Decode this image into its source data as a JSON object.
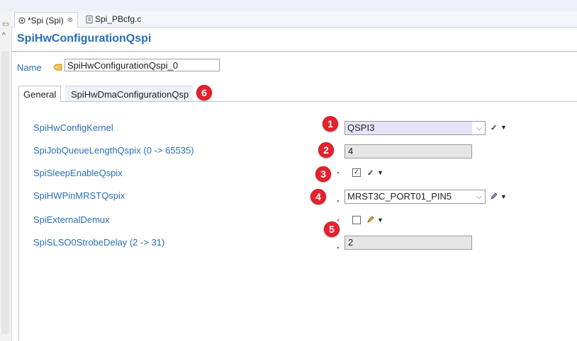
{
  "editor_tabs": [
    {
      "label": "*Spi (Spi)",
      "close": "⊗"
    },
    {
      "label": "Spi_PBcfg.c"
    }
  ],
  "section_title": "SpiHwConfigurationQspi",
  "name_field": {
    "label": "Name",
    "value": "SpiHwConfigurationQspi_0"
  },
  "subtabs": [
    {
      "label": "General"
    },
    {
      "label": "SpiHwDmaConfigurationQsp"
    }
  ],
  "properties": [
    {
      "label": "SpiHwConfigKernel",
      "control": "combo",
      "value": "QSPI3"
    },
    {
      "label": "SpiJobQueueLengthQspix (0 -> 65535)",
      "control": "text",
      "value": "4"
    },
    {
      "label": "SpiSleepEnableQspix",
      "control": "checkbox",
      "checked": true
    },
    {
      "label": "SpiHWPinMRSTQspix",
      "control": "combo",
      "value": "MRST3C_PORT01_PIN5"
    },
    {
      "label": "SpiExternalDemux",
      "control": "checkbox",
      "checked": false
    },
    {
      "label": "SpiSLSO0StrobeDelay (2 -> 31)",
      "control": "text",
      "value": "2"
    }
  ],
  "badges": [
    "1",
    "2",
    "3",
    "4",
    "5",
    "6"
  ],
  "icons": {
    "tab_editor": "editor-icon",
    "tab_file": "file-icon",
    "name": "tag-icon",
    "setting": "setting-icon",
    "edit": "pencil-icon"
  },
  "colors": {
    "accent": "#2a6fb5",
    "badge": "#e8212e",
    "combo_highlight": "#e4e4f8"
  }
}
